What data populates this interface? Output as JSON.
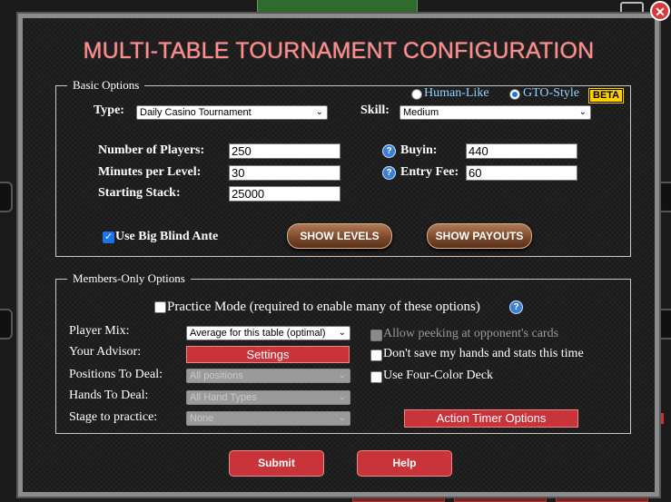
{
  "dialog": {
    "title": "MULTI-TABLE TOURNAMENT CONFIGURATION",
    "close_label": "✕"
  },
  "basic": {
    "legend": "Basic Options",
    "style_options": [
      {
        "label": "Human-Like",
        "selected": false
      },
      {
        "label": "GTO-Style",
        "selected": true
      }
    ],
    "beta_badge": "BETA",
    "type_label": "Type:",
    "type_value": "Daily Casino Tournament",
    "skill_label": "Skill:",
    "skill_value": "Medium",
    "players_label": "Number of Players:",
    "players_value": "250",
    "minutes_label": "Minutes per Level:",
    "minutes_value": "30",
    "stack_label": "Starting Stack:",
    "stack_value": "25000",
    "buyin_label": "Buyin:",
    "buyin_value": "440",
    "entry_fee_label": "Entry Fee:",
    "entry_fee_value": "60",
    "big_blind_ante_label": "Use Big Blind Ante",
    "big_blind_ante_checked": true,
    "show_levels_label": "SHOW LEVELS",
    "show_payouts_label": "SHOW PAYOUTS"
  },
  "members": {
    "legend": "Members-Only Options",
    "practice_mode_label": "Practice Mode (required to enable many of these options)",
    "practice_mode_checked": false,
    "player_mix_label": "Player Mix:",
    "player_mix_value": "Average for this table (optimal)",
    "advisor_label": "Your Advisor:",
    "settings_label": "Settings",
    "positions_label": "Positions To Deal:",
    "positions_value": "All positions",
    "hands_label": "Hands To Deal:",
    "hands_value": "All Hand Types",
    "stage_label": "Stage to practice:",
    "stage_value": "None",
    "allow_peeking_label": "Allow peeking at opponent's cards",
    "dont_save_label": "Don't save my hands and stats this time",
    "four_color_label": "Use Four-Color Deck",
    "action_timer_label": "Action Timer Options"
  },
  "footer": {
    "submit_label": "Submit",
    "help_label": "Help"
  },
  "colors": {
    "title": "#ff8b8b",
    "accent_red": "#c9343a",
    "radio_text": "#8fd3ff",
    "beta_bg": "#ffd000"
  }
}
